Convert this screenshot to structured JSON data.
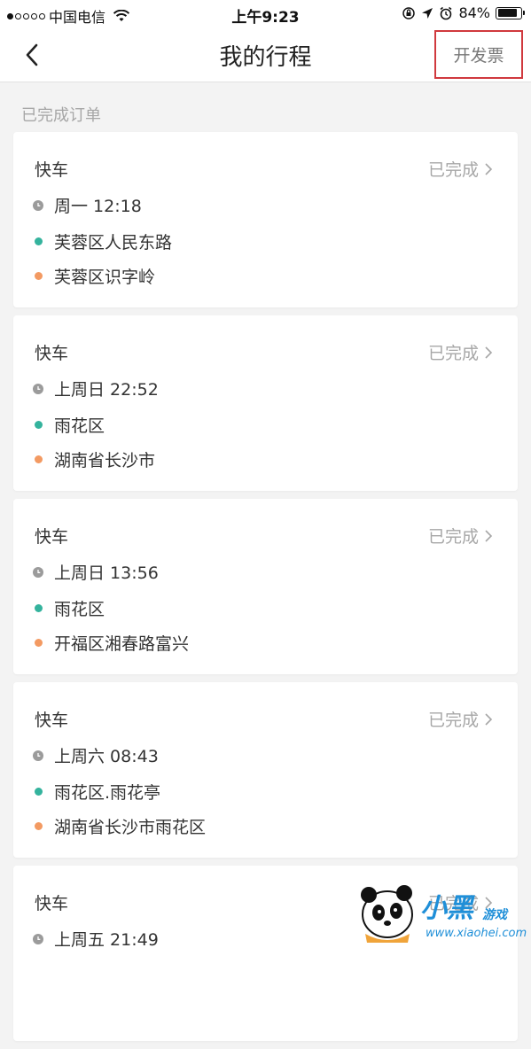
{
  "status_bar": {
    "carrier": "中国电信",
    "time": "上午9:23",
    "battery": "84%",
    "battery_level": 0.84
  },
  "nav": {
    "title": "我的行程",
    "invoice_label": "开发票"
  },
  "section_label": "已完成订单",
  "trips": [
    {
      "type": "快车",
      "status": "已完成",
      "time": "周一 12:18",
      "from": "芙蓉区人民东路",
      "to": "芙蓉区识字岭"
    },
    {
      "type": "快车",
      "status": "已完成",
      "time": "上周日 22:52",
      "from": "雨花区",
      "to": "湖南省长沙市"
    },
    {
      "type": "快车",
      "status": "已完成",
      "time": "上周日 13:56",
      "from": "雨花区",
      "to": "开福区湘春路富兴"
    },
    {
      "type": "快车",
      "status": "已完成",
      "time": "上周六 08:43",
      "from": "雨花区.雨花亭",
      "to": "湖南省长沙市雨花区"
    },
    {
      "type": "快车",
      "status": "已完成",
      "time": "上周五 21:49",
      "from": "",
      "to": ""
    }
  ],
  "watermark": {
    "title": "小黑",
    "subtitle": "游戏",
    "url": "www.xiaohei.com"
  },
  "colors": {
    "accent_green": "#34b39d",
    "accent_orange": "#f39a62",
    "highlight_red": "#d0393e"
  }
}
